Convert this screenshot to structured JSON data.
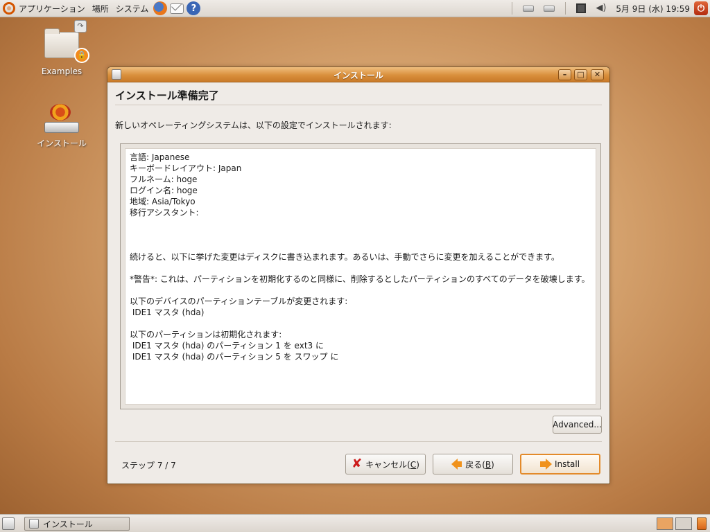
{
  "top_panel": {
    "menus": [
      "アプリケーション",
      "場所",
      "システム"
    ],
    "clock": "5月 9日 (水) 19:59"
  },
  "desktop": {
    "icons": [
      {
        "label": "Examples"
      },
      {
        "label": "インストール"
      }
    ]
  },
  "window": {
    "title": "インストール",
    "heading": "インストール準備完了",
    "intro": "新しいオペレーティングシステムは、以下の設定でインストールされます:",
    "summary_lines": [
      "言語: Japanese",
      "キーボードレイアウト: Japan",
      "フルネーム: hoge",
      "ログイン名: hoge",
      "地域: Asia/Tokyo",
      "移行アシスタント:",
      "",
      "",
      "",
      "続けると、以下に挙げた変更はディスクに書き込まれます。あるいは、手動でさらに変更を加えることができます。",
      "",
      "*警告*: これは、パーティションを初期化するのと同様に、削除するとしたパーティションのすべてのデータを破壊します。",
      "",
      "以下のデバイスのパーティションテーブルが変更されます:",
      " IDE1 マスタ (hda)",
      "",
      "以下のパーティションは初期化されます:",
      " IDE1 マスタ (hda) のパーティション 1 を ext3 に",
      " IDE1 マスタ (hda) のパーティション 5 を スワップ に"
    ],
    "advanced_label": "Advanced...",
    "step_label": "ステップ 7 / 7",
    "cancel_label": "キャンセル(",
    "cancel_key": "C",
    "back_label": "戻る(",
    "back_key": "B",
    "paren_close": ")",
    "install_label": "Install"
  },
  "taskbar": {
    "task_label": "インストール"
  }
}
